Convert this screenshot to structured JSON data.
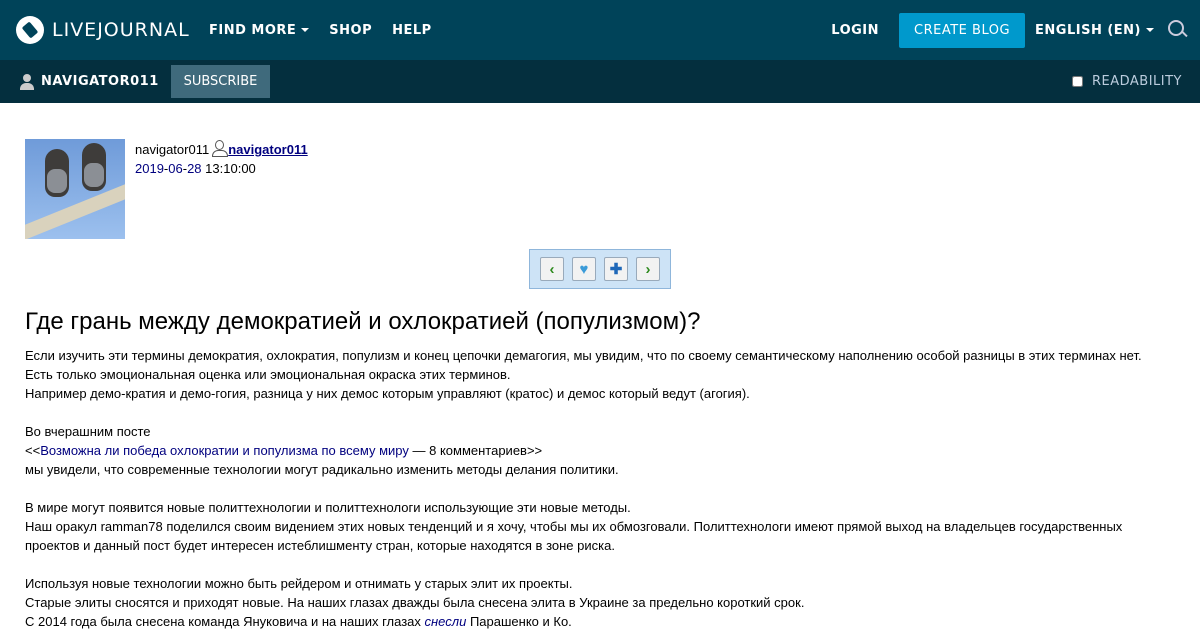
{
  "app": {
    "logo_text": "LIVEJOURNAL",
    "colors": {
      "topbar": "#004359",
      "subbar": "#042f3e",
      "accent": "#0099cc",
      "link": "#00007f"
    }
  },
  "topnav": {
    "items": [
      "FIND MORE",
      "SHOP",
      "HELP"
    ],
    "login": "LOGIN",
    "create_blog": "CREATE BLOG",
    "language": "ENGLISH (EN)"
  },
  "subnav": {
    "username": "NAVIGATOR011",
    "subscribe": "SUBSCRIBE",
    "readability": "READABILITY"
  },
  "entry": {
    "author_plain": "navigator011",
    "author_link": "navigator011",
    "date_year": "2019",
    "date_month": "06",
    "date_day": "28",
    "time": "13:10:00",
    "title": "Где грань между демократией и охлократией (популизмом)?",
    "p1": "Если изучить эти термины демократия, охлократия, популизм и конец цепочки демагогия, мы увидим, что по своему семантическому наполнению особой разницы в этих терминах нет.",
    "p2": "Есть только эмоциональная оценка или эмоциональная окраска этих терминов.",
    "p3": "Например демо-кратия и демо-гогия, разница у них демос которым управляют (кратос) и демос который ведут (агогия).",
    "p4": "Во вчерашним посте",
    "p5_prefix": "<<",
    "p5_link": "Возможна ли победа охлократии и популизма по всему миру",
    "p5_suffix": " — 8 комментариев>>",
    "p6": "мы увидели, что современные технологии могут радикально изменить методы делания политики.",
    "p7": "В мире могут появится новые политтехнологии и политтехнологи использующие эти новые методы.",
    "p8": "Наш оракул ramman78 поделился своим видением этих новых тенденций и я хочу, чтобы мы их обмозговали. Политтехнологи имеют прямой выход на владельцев государственных проектов и данный пост будет интересен истеблишменту стран, которые находятся в зоне риска.",
    "p9": "Используя новые технологии можно быть рейдером и отнимать у старых элит их проекты.",
    "p10": "Старые элиты сносятся и приходят новые. На наших глазах дважды была снесена элита в Украине за предельно короткий срок.",
    "p11_prefix": "С 2014 года была снесена команда Януковича и на наших глазах ",
    "p11_link": "снесли",
    "p11_suffix": " Парашенко и Ко."
  },
  "entry_nav": {
    "icons": [
      "chevron-left-icon",
      "heart-icon",
      "plus-icon",
      "chevron-right-icon"
    ]
  }
}
